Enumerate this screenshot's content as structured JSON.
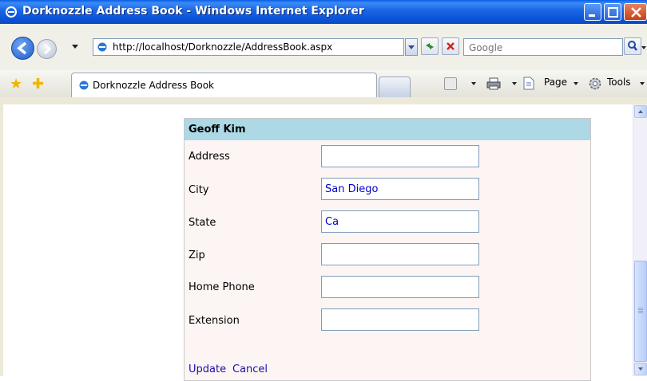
{
  "window": {
    "title": "Dorknozzle Address Book - Windows Internet Explorer"
  },
  "toolbar": {
    "url": "http://localhost/Dorknozzle/AddressBook.aspx",
    "search_placeholder": "Google"
  },
  "tabs": [
    {
      "label": "Dorknozzle Address Book"
    }
  ],
  "command_bar": {
    "page_label": "Page",
    "tools_label": "Tools"
  },
  "form": {
    "header": "Geoff Kim",
    "fields": [
      {
        "label": "Address",
        "value": ""
      },
      {
        "label": "City",
        "value": "San Diego"
      },
      {
        "label": "State",
        "value": "Ca"
      },
      {
        "label": "Zip",
        "value": ""
      },
      {
        "label": "Home Phone",
        "value": ""
      },
      {
        "label": "Extension",
        "value": ""
      }
    ],
    "actions": {
      "update": "Update",
      "cancel": "Cancel"
    }
  },
  "colors": {
    "header_bg": "#add8e6",
    "card_bg": "#fdf5f4",
    "link": "#1a0dab",
    "input_text": "#0000cd"
  }
}
